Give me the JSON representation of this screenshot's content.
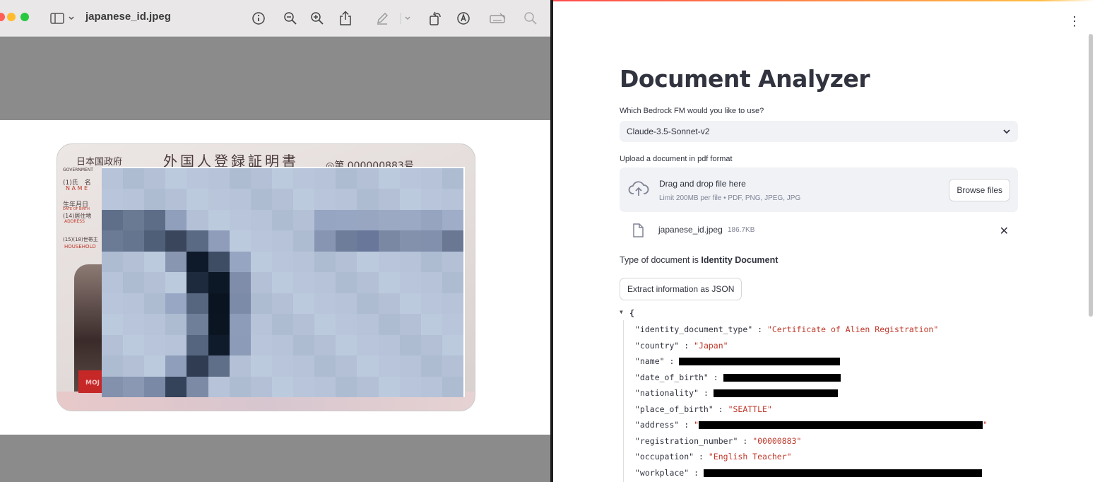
{
  "preview": {
    "title": "japanese_id.jpeg",
    "card": {
      "gov_label": "日本国政府",
      "gov_sub": "GOVERNMENT",
      "heading": "外国人登録証明書",
      "number_label": "◎第 000000883号",
      "name_label": "(1)氏　名",
      "name_sub": "N A M E",
      "dob_label": "生年月日",
      "dob_sub": "DATE OF BIRTH",
      "address_label": "(14)居住地",
      "address_sub": "ADDRESS",
      "household_label": "(15)(18)世帯主",
      "household_sub": "HOUSEHOLD",
      "seal_text": "MOJ"
    }
  },
  "app": {
    "title": "Document Analyzer",
    "model_label": "Which Bedrock FM would you like to use?",
    "model_value": "Claude-3.5-Sonnet-v2",
    "upload_label": "Upload a document in pdf format",
    "dropzone_title": "Drag and drop file here",
    "dropzone_limit": "Limit 200MB per file • PDF, PNG, JPEG, JPG",
    "browse_label": "Browse files",
    "file_name": "japanese_id.jpeg",
    "file_size": "186.7KB",
    "doc_type_prefix": "Type of document is ",
    "doc_type_value": "Identity Document",
    "extract_label": "Extract information as JSON",
    "json_open": "{",
    "json": [
      {
        "key": "\"identity_document_type\"",
        "value": "\"Certificate of Alien Registration\""
      },
      {
        "key": "\"country\"",
        "value": "\"Japan\""
      },
      {
        "key": "\"name\"",
        "value": "",
        "redacted": true
      },
      {
        "key": "\"date_of_birth\"",
        "value": "",
        "redacted": true
      },
      {
        "key": "\"nationality\"",
        "value": "",
        "redacted": true
      },
      {
        "key": "\"place_of_birth\"",
        "value": "\"SEATTLE\""
      },
      {
        "key": "\"address\"",
        "value": "\"",
        "value_end": "\"",
        "redacted": true
      },
      {
        "key": "\"registration_number\"",
        "value": "\"00000883\""
      },
      {
        "key": "\"occupation\"",
        "value": "\"English Teacher\""
      },
      {
        "key": "\"workplace\"",
        "value": "",
        "redacted": true
      }
    ]
  }
}
